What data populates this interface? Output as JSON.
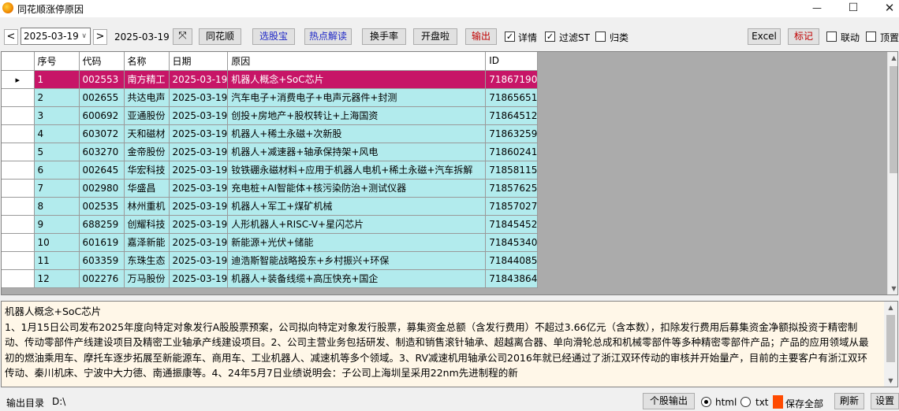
{
  "window": {
    "title": "同花顺涨停原因",
    "controls": [
      "—",
      "☐",
      "✕"
    ]
  },
  "toolbar": {
    "prev": "<",
    "date_value": "2025-03-19",
    "next": ">",
    "date_label": "2025-03-19",
    "buttons": {
      "ths": "同花顺",
      "xgb": "选股宝",
      "hot": "热点解读",
      "turnover": "换手率",
      "kpl": "开盘啦",
      "export": "输出"
    },
    "checks": {
      "detail": "详情",
      "filter_st": "过滤ST",
      "archive": "归类"
    },
    "excel": "Excel",
    "mark": "标记",
    "link": "联动",
    "top": "顶置"
  },
  "table": {
    "columns": [
      "序号",
      "代码",
      "名称",
      "日期",
      "原因",
      "ID"
    ],
    "selected_row": 0,
    "rows": [
      [
        "1",
        "002553",
        "南方精工",
        "2025-03-19",
        "机器人概念+SoC芯片",
        "71867190"
      ],
      [
        "2",
        "002655",
        "共达电声",
        "2025-03-19",
        "汽车电子+消费电子+电声元器件+封测",
        "71865651"
      ],
      [
        "3",
        "600692",
        "亚通股份",
        "2025-03-19",
        "创投+房地产+股权转让+上海国资",
        "71864512"
      ],
      [
        "4",
        "603072",
        "天和磁材",
        "2025-03-19",
        "机器人+稀土永磁+次新股",
        "71863259"
      ],
      [
        "5",
        "603270",
        "金帝股份",
        "2025-03-19",
        "机器人+减速器+轴承保持架+风电",
        "71860241"
      ],
      [
        "6",
        "002645",
        "华宏科技",
        "2025-03-19",
        "钕铁硼永磁材料+应用于机器人电机+稀土永磁+汽车拆解",
        "71858115"
      ],
      [
        "7",
        "002980",
        "华盛昌",
        "2025-03-19",
        "充电桩+AI智能体+核污染防治+测试仪器",
        "71857625"
      ],
      [
        "8",
        "002535",
        "林州重机",
        "2025-03-19",
        "机器人+军工+煤矿机械",
        "71857027"
      ],
      [
        "9",
        "688259",
        "创耀科技",
        "2025-03-19",
        "人形机器人+RISC-V+星闪芯片",
        "71845452"
      ],
      [
        "10",
        "601619",
        "嘉泽新能",
        "2025-03-19",
        "新能源+光伏+储能",
        "71845340"
      ],
      [
        "11",
        "603359",
        "东珠生态",
        "2025-03-19",
        "迪浩斯智能战略投东+乡村振兴+环保",
        "71844085"
      ],
      [
        "12",
        "002276",
        "万马股份",
        "2025-03-19",
        "机器人+装备线缆+高压快充+国企",
        "71843864"
      ]
    ]
  },
  "detail": {
    "text": "机器人概念+SoC芯片\n1、1月15日公司发布2025年度向特定对象发行A股股票预案，公司拟向特定对象发行股票，募集资金总额（含发行费用）不超过3.66亿元（含本数），扣除发行费用后募集资金净额拟投资于精密制动、传动零部件产线建设项目及精密工业轴承产线建设项目。2、公司主营业务包括研发、制造和销售滚针轴承、超越离合器、单向滑轮总成和机械零部件等多种精密零部件产品；产品的应用领域从最初的燃油乘用车、摩托车逐步拓展至新能源车、商用车、工业机器人、减速机等多个领域。3、RV减速机用轴承公司2016年就已经通过了浙江双环传动的审核并开始量产，目前的主要客户有浙江双环传动、秦川机床、宁波中大力德、南通振康等。4、24年5月7日业绩说明会：子公司上海圳呈采用22nm先进制程的新"
  },
  "statusbar": {
    "output_label": "输出目录",
    "output_dir": "D:\\",
    "single_export": "个股输出",
    "html": "html",
    "txt": "txt",
    "save_all": "保存全部",
    "refresh": "刷新",
    "settings": "设置"
  },
  "colors": {
    "selected_row": "#c71567",
    "row_bg": "#b2ebed",
    "detail_bg": "#fff7e8",
    "save_swatch": "#ff4a00"
  }
}
